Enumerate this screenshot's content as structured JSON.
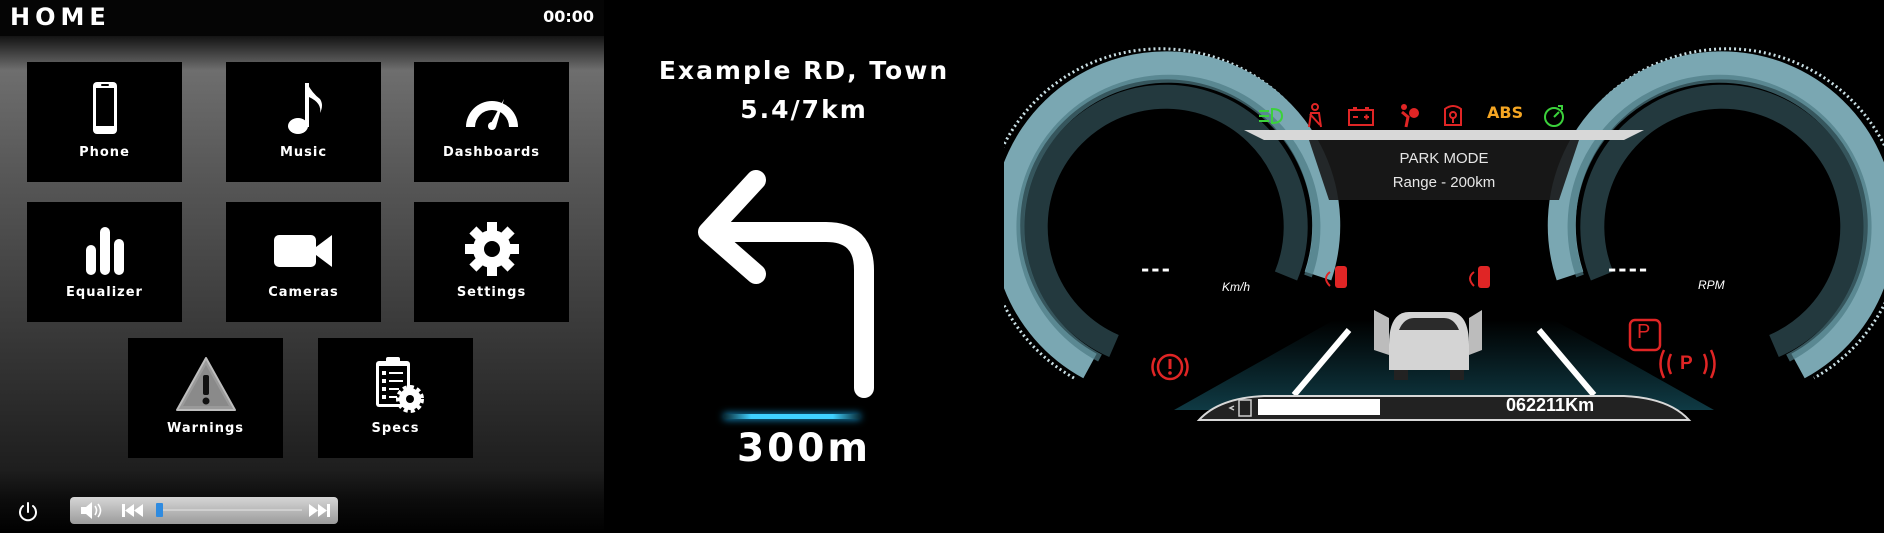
{
  "home": {
    "title": "HOME",
    "clock": "00:00",
    "tiles": [
      {
        "label": "Phone",
        "icon": "phone-icon"
      },
      {
        "label": "Music",
        "icon": "music-note-icon"
      },
      {
        "label": "Dashboards",
        "icon": "speedometer-icon"
      },
      {
        "label": "Equalizer",
        "icon": "equalizer-icon"
      },
      {
        "label": "Cameras",
        "icon": "video-camera-icon"
      },
      {
        "label": "Settings",
        "icon": "gear-icon"
      },
      {
        "label": "Warnings",
        "icon": "warning-triangle-icon"
      },
      {
        "label": "Specs",
        "icon": "clipboard-gear-icon"
      }
    ],
    "media": {
      "progress": 0.0
    }
  },
  "navigation": {
    "street": "Example RD, Town",
    "distance_total": "5.4/7km",
    "turn_direction": "left",
    "turn_distance": "300m",
    "accent_color": "#3fd0ff"
  },
  "cluster": {
    "warning_lights": [
      {
        "name": "headlight-icon",
        "color": "#3bd13b"
      },
      {
        "name": "seatbelt-icon",
        "color": "#e02525"
      },
      {
        "name": "battery-icon",
        "color": "#e02525"
      },
      {
        "name": "airbag-icon",
        "color": "#e02525"
      },
      {
        "name": "engine-check-icon",
        "color": "#e02525"
      },
      {
        "name": "abs-icon",
        "label": "ABS",
        "color": "#f5a623"
      },
      {
        "name": "eco-icon",
        "color": "#3bd13b"
      }
    ],
    "mode": "PARK MODE",
    "range": "Range - 200km",
    "speed_value": "---",
    "speed_unit": "Km/h",
    "rpm_value": "----",
    "rpm_unit": "RPM",
    "odometer": "062211Km",
    "park_indicator": "P",
    "gauge_color": "#6f9aa4",
    "warning_color": "#e02525"
  }
}
